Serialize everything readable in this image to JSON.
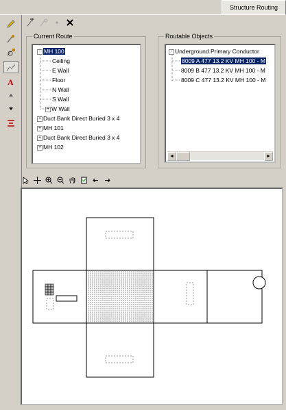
{
  "tab": {
    "label": "Structure Routing"
  },
  "left_tools": [
    {
      "icon": "pencil-icon"
    },
    {
      "icon": "route-pencil-icon"
    },
    {
      "icon": "node-route-icon"
    },
    {
      "icon": "trace-route-icon",
      "selected": true
    },
    {
      "icon": "text-a-icon"
    },
    {
      "icon": "arrow-up-icon"
    },
    {
      "icon": "arrow-down-icon"
    },
    {
      "icon": "text-route-icon"
    }
  ],
  "top_tools": [
    {
      "icon": "add-route-icon"
    },
    {
      "icon": "disabled-route-icon"
    },
    {
      "icon": "small-dot-icon"
    },
    {
      "icon": "delete-x-icon"
    }
  ],
  "current_route": {
    "legend": "Current Route",
    "items": [
      {
        "label": "MH 100",
        "level": 0,
        "toggle": "-",
        "selected": true
      },
      {
        "label": "Ceiling",
        "level": 1
      },
      {
        "label": "E Wall",
        "level": 1
      },
      {
        "label": "Floor",
        "level": 1
      },
      {
        "label": "N Wall",
        "level": 1
      },
      {
        "label": "S Wall",
        "level": 1
      },
      {
        "label": "W Wall",
        "level": 1,
        "toggle": "+"
      },
      {
        "label": "Duct Bank Direct Buried 3 x 4",
        "level": 0,
        "toggle": "+"
      },
      {
        "label": "MH 101",
        "level": 0,
        "toggle": "+"
      },
      {
        "label": "Duct Bank Direct Buried 3 x 4",
        "level": 0,
        "toggle": "+"
      },
      {
        "label": "MH 102",
        "level": 0,
        "toggle": "+"
      }
    ]
  },
  "routable_objects": {
    "legend": "Routable Objects",
    "items": [
      {
        "label": "Underground Primary Conductor",
        "level": 0,
        "toggle": "-"
      },
      {
        "label": "8009 A 477 13.2 KV MH 100 - M",
        "level": 1,
        "selected": true
      },
      {
        "label": "8009 B 477 13.2 KV MH 100 - M",
        "level": 1
      },
      {
        "label": "8009 C 477 13.2 KV MH 100 - M",
        "level": 1
      }
    ],
    "scroll_left": "◄",
    "scroll_right": "►"
  },
  "view_tools": [
    {
      "icon": "select-arrow-icon"
    },
    {
      "icon": "pan-cross-icon"
    },
    {
      "icon": "zoom-in-icon"
    },
    {
      "icon": "zoom-out-icon"
    },
    {
      "icon": "hand-pan-icon"
    },
    {
      "icon": "page-icon"
    },
    {
      "icon": "back-arrow-icon"
    },
    {
      "icon": "forward-arrow-icon"
    }
  ]
}
